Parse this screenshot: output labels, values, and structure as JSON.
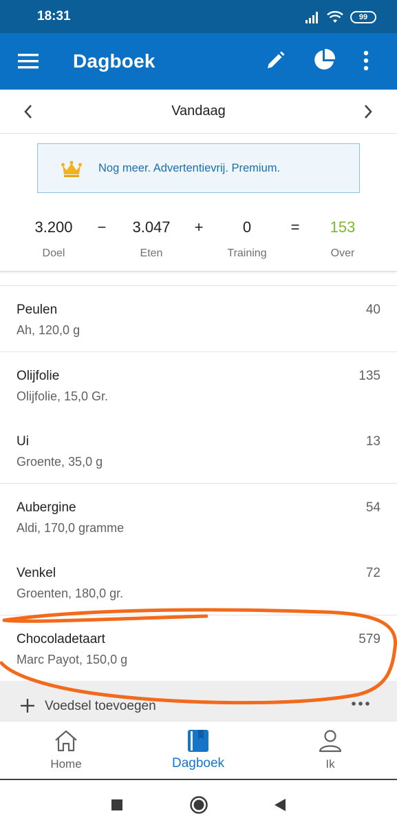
{
  "status_bar": {
    "time": "18:31",
    "battery": "99"
  },
  "app_bar": {
    "title": "Dagboek"
  },
  "date_nav": {
    "label": "Vandaag"
  },
  "premium_banner": {
    "text": "Nog meer. Advertentievrij. Premium."
  },
  "summary": {
    "goal": {
      "value": "3.200",
      "label": "Doel"
    },
    "minus": "−",
    "food": {
      "value": "3.047",
      "label": "Eten"
    },
    "plus": "+",
    "exercise": {
      "value": "0",
      "label": "Training"
    },
    "equals": "=",
    "remaining": {
      "value": "153",
      "label": "Over"
    },
    "remaining_color": "#7cb82f"
  },
  "food_items": [
    {
      "name": "Peulen",
      "desc": "Ah, 120,0 g",
      "cal": "40"
    },
    {
      "name": "Olijfolie",
      "desc": "Olijfolie, 15,0 Gr.",
      "cal": "135"
    },
    {
      "name": "Ui",
      "desc": "Groente, 35,0 g",
      "cal": "13"
    },
    {
      "name": "Aubergine",
      "desc": "Aldi, 170,0 gramme",
      "cal": "54"
    },
    {
      "name": "Venkel",
      "desc": "Groenten, 180,0 gr.",
      "cal": "72"
    },
    {
      "name": "Chocoladetaart",
      "desc": "Marc Payot, 150,0 g",
      "cal": "579"
    }
  ],
  "add_food": {
    "label": "Voedsel toevoegen"
  },
  "bottom_nav": [
    {
      "label": "Home",
      "icon": "home-icon"
    },
    {
      "label": "Dagboek",
      "icon": "diary-icon"
    },
    {
      "label": "Ik",
      "icon": "person-icon"
    }
  ],
  "colors": {
    "app_bar": "#0a71c4",
    "status_bar": "#0c5e98",
    "accent": "#1775c9",
    "annotation": "#f26b1d"
  }
}
